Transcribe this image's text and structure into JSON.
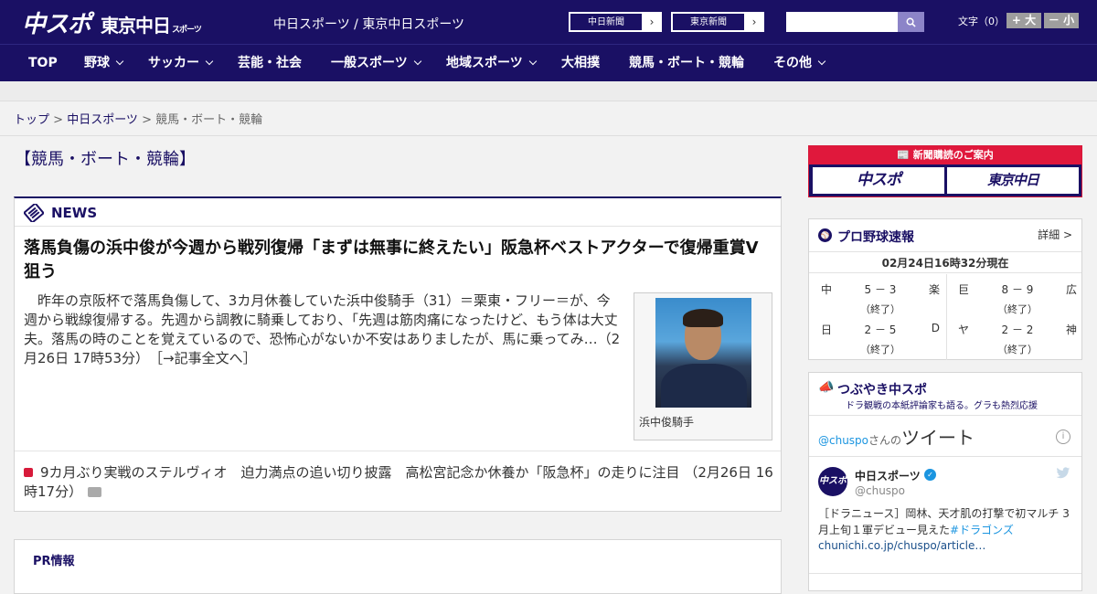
{
  "header": {
    "logo_chuspo": "中スポ",
    "logo_tokyo": "東京中日",
    "logo_tokyo_small": "スポーツ",
    "site_links": "中日スポーツ / 東京中日スポーツ",
    "chunichi_button": "中日新聞",
    "tokyo_button": "東京新聞",
    "search_placeholder": "",
    "font_size_label": "文字（0）",
    "font_larger": "+ 大",
    "font_smaller": "－ 小"
  },
  "nav": {
    "items": [
      {
        "label": "TOP",
        "has_menu": false
      },
      {
        "label": "野球",
        "has_menu": true
      },
      {
        "label": "サッカー",
        "has_menu": true
      },
      {
        "label": "芸能・社会",
        "has_menu": false
      },
      {
        "label": "一般スポーツ",
        "has_menu": true
      },
      {
        "label": "地域スポーツ",
        "has_menu": true
      },
      {
        "label": "大相撲",
        "has_menu": false
      },
      {
        "label": "競馬・ボート・競輪",
        "has_menu": false
      },
      {
        "label": "その他",
        "has_menu": true
      }
    ]
  },
  "breadcrumb": {
    "top": "トップ",
    "sep1": " > ",
    "chunichi_sports": "中日スポーツ",
    "sep2": " > ",
    "current": "競馬・ボート・競輪"
  },
  "page": {
    "title": "【競馬・ボート・競輪】"
  },
  "news": {
    "label": "NEWS",
    "headline": "落馬負傷の浜中俊が今週から戦列復帰「まずは無事に終えたい」阪急杯ベストアクターで復帰重賞V狙う",
    "body": "昨年の京阪杯で落馬負傷して、3カ月休養していた浜中俊騎手（31）＝栗東・フリー＝が、今週から戦線復帰する。先週から調教に騎乗しており、「先週は筋肉痛になったけど、もう体は大丈夫。落馬の時のことを覚えているので、恐怖心がないか不安はありましたが、馬に乗ってみ…（2月26日 17時53分）",
    "more": "［→記事全文へ］",
    "photo_caption": "浜中俊騎手",
    "sub_item": "9カ月ぶり実戦のステルヴィオ　迫力満点の追い切り披露　高松宮記念か休養か「阪急杯」の走りに注目 （2月26日 16時17分）"
  },
  "pr": {
    "label": "PR情報"
  },
  "subscribe": {
    "bar": "新聞購読のご案内",
    "chuspo": "中スポ",
    "tokyo": "東京中日"
  },
  "baseball": {
    "title": "プロ野球速報",
    "detail": "詳細 >",
    "updated": "02月24日16時32分現在",
    "games": [
      {
        "home": "中",
        "score": "5 － 3",
        "away": "楽",
        "status": "（終了）"
      },
      {
        "home": "巨",
        "score": "8 － 9",
        "away": "広",
        "status": "（終了）"
      },
      {
        "home": "日",
        "score": "2 － 5",
        "away": "D",
        "status": "（終了）"
      },
      {
        "home": "ヤ",
        "score": "2 － 2",
        "away": "神",
        "status": "（終了）"
      }
    ]
  },
  "tweets": {
    "title": "つぶやき中スポ",
    "subtitle": "ドラ観戦の本紙評論家も語る。グラも熱烈応援",
    "timeline_handle": "@chuspo",
    "timeline_san": "さんの",
    "timeline_word": "ツイート",
    "info": "i",
    "user_name": "中日スポーツ",
    "user_handle": "@chuspo",
    "avatar_text": "中スポ",
    "tweet_text": "［ドラニュース］岡林、天才肌の打撃で初マルチ 3月上旬１軍デビュー見えた",
    "tweet_hashtag": "#ドラゴンズ",
    "tweet_link": "chunichi.co.jp/chuspo/article…"
  },
  "colors": {
    "brand_navy": "#1a1064",
    "accent_red": "#e0183c",
    "twitter_blue": "#1b95e0"
  }
}
